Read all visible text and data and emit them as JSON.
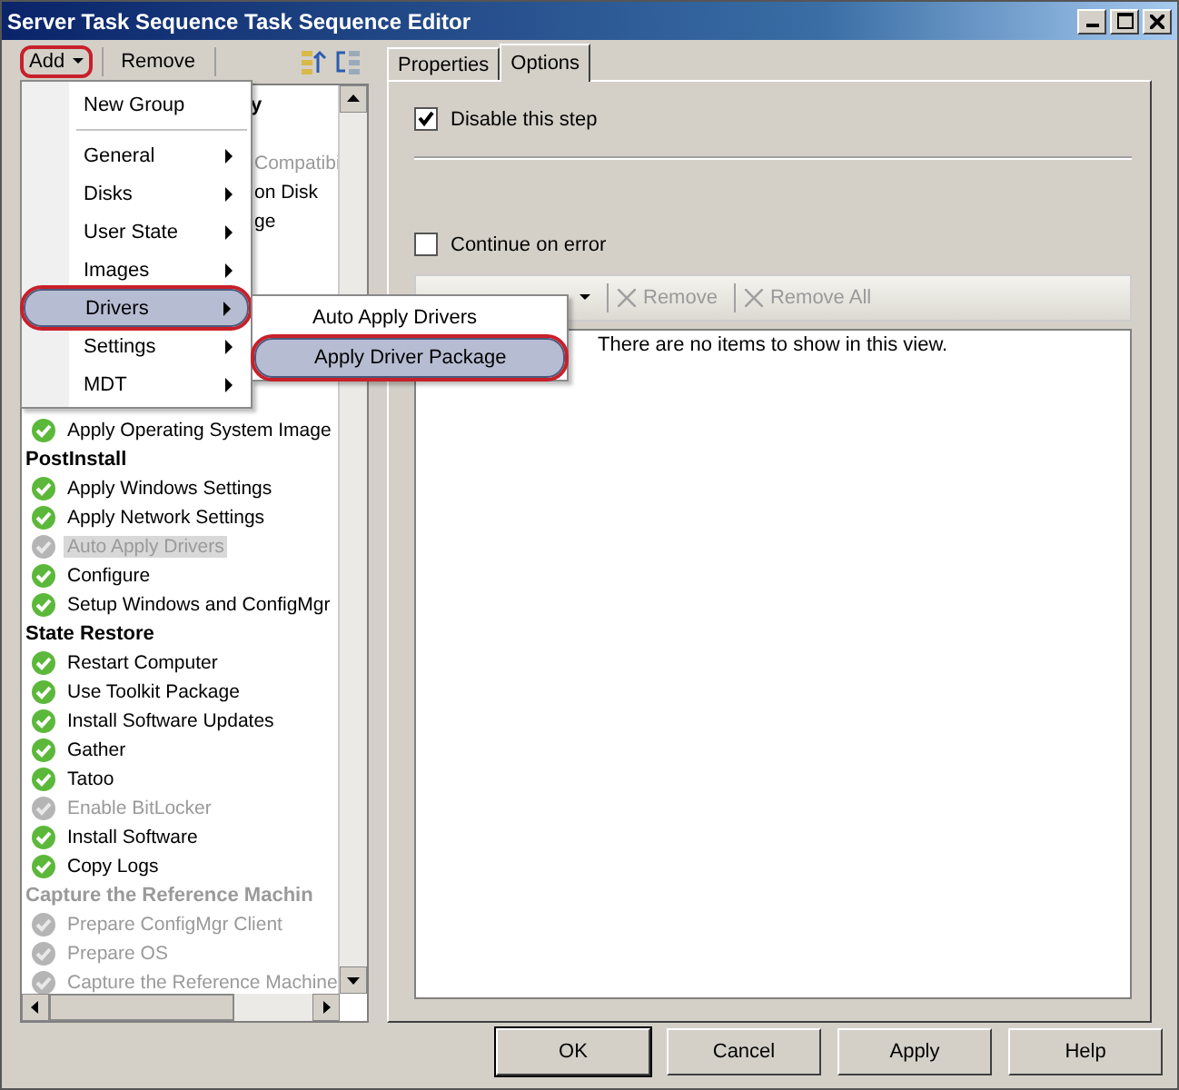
{
  "window": {
    "title": "Server Task Sequence Task Sequence Editor"
  },
  "toolbar": [
    {
      "label": "Add",
      "kind": "dropdown",
      "circled": true
    },
    {
      "label": "Remove",
      "kind": "button",
      "circled": false
    }
  ],
  "tree": {
    "items": [
      {
        "kind": "group",
        "text": "y",
        "enabled": true,
        "covered": true
      },
      {
        "kind": "step",
        "text": "Compatibi",
        "enabled": false,
        "covered": true
      },
      {
        "kind": "step",
        "text": "on Disk",
        "enabled": true,
        "covered": true
      },
      {
        "kind": "step",
        "text": "ge",
        "enabled": true,
        "covered": true
      },
      {
        "kind": "step",
        "text": "Apply Operating System Image",
        "enabled": true,
        "selected": false
      },
      {
        "kind": "group",
        "text": "PostInstall",
        "enabled": true,
        "children": [
          {
            "kind": "step",
            "text": "Apply Windows Settings",
            "enabled": true,
            "selected": false
          },
          {
            "kind": "step",
            "text": "Apply Network Settings",
            "enabled": true,
            "selected": false
          },
          {
            "kind": "step",
            "text": "Auto Apply Drivers",
            "enabled": false,
            "selected": true
          },
          {
            "kind": "step",
            "text": "Configure",
            "enabled": true,
            "selected": false
          },
          {
            "kind": "step",
            "text": "Setup Windows and ConfigMgr",
            "enabled": true,
            "selected": false
          }
        ]
      },
      {
        "kind": "group",
        "text": "State Restore",
        "enabled": true,
        "children": [
          {
            "kind": "step",
            "text": "Restart Computer",
            "enabled": true,
            "selected": false
          },
          {
            "kind": "step",
            "text": "Use Toolkit Package",
            "enabled": true,
            "selected": false
          },
          {
            "kind": "step",
            "text": "Install Software Updates",
            "enabled": true,
            "selected": false
          },
          {
            "kind": "step",
            "text": "Gather",
            "enabled": true,
            "selected": false
          },
          {
            "kind": "step",
            "text": "Tatoo",
            "enabled": true,
            "selected": false
          },
          {
            "kind": "step",
            "text": "Enable BitLocker",
            "enabled": false,
            "selected": false
          },
          {
            "kind": "step",
            "text": "Install Software",
            "enabled": true,
            "selected": false
          },
          {
            "kind": "step",
            "text": "Copy Logs",
            "enabled": true,
            "selected": false
          }
        ]
      },
      {
        "kind": "group",
        "text": "Capture the Reference Machin",
        "enabled": false,
        "children": [
          {
            "kind": "step",
            "text": "Prepare ConfigMgr Client",
            "enabled": false,
            "selected": false
          },
          {
            "kind": "step",
            "text": "Prepare OS",
            "enabled": false,
            "selected": false
          },
          {
            "kind": "step",
            "text": "Capture the Reference Machine",
            "enabled": false,
            "selected": false
          }
        ]
      }
    ]
  },
  "add_menu": [
    {
      "kind": "item",
      "label": "New Group",
      "submenu": false,
      "selected": false,
      "circled": false
    },
    {
      "kind": "separator"
    },
    {
      "kind": "item",
      "label": "General",
      "submenu": true,
      "selected": false,
      "circled": false
    },
    {
      "kind": "item",
      "label": "Disks",
      "submenu": true,
      "selected": false,
      "circled": false
    },
    {
      "kind": "item",
      "label": "User State",
      "submenu": true,
      "selected": false,
      "circled": false
    },
    {
      "kind": "item",
      "label": "Images",
      "submenu": true,
      "selected": false,
      "circled": false
    },
    {
      "kind": "item",
      "label": "Drivers",
      "submenu": true,
      "selected": true,
      "circled": true
    },
    {
      "kind": "item",
      "label": "Settings",
      "submenu": true,
      "selected": false,
      "circled": false
    },
    {
      "kind": "item",
      "label": "MDT",
      "submenu": true,
      "selected": false,
      "circled": false
    }
  ],
  "submenu": [
    {
      "label": "Auto Apply Drivers",
      "selected": false,
      "circled": false
    },
    {
      "label": "Apply Driver Package",
      "selected": true,
      "circled": true
    }
  ],
  "tabs": [
    {
      "label": "Properties",
      "selected": false
    },
    {
      "label": "Options",
      "selected": true
    }
  ],
  "options": {
    "checkboxes": [
      {
        "label": "Disable this step",
        "checked": true
      },
      {
        "label": "Continue on error",
        "checked": false
      }
    ],
    "list_toolbar": [
      {
        "label": "Remove",
        "disabled": true
      },
      {
        "label": "Remove All",
        "disabled": true
      }
    ],
    "empty_text": "There are no items to show in this view."
  },
  "buttons": [
    {
      "label": "OK",
      "default": true
    },
    {
      "label": "Cancel",
      "default": false
    },
    {
      "label": "Apply",
      "default": false
    },
    {
      "label": "Help",
      "default": false
    }
  ]
}
